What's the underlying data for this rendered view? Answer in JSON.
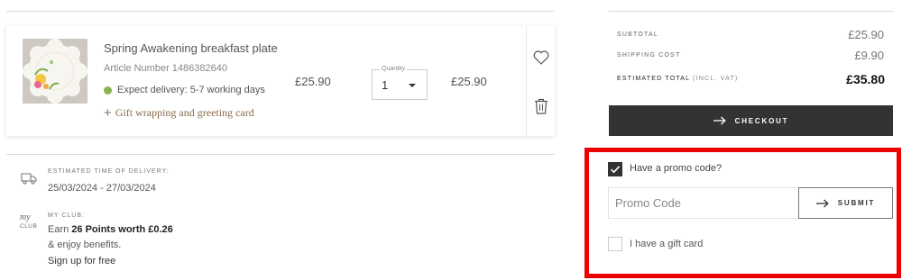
{
  "cart_item": {
    "title": "Spring Awakening breakfast plate",
    "article_number": "Article Number 1486382640",
    "delivery_estimate": "Expect delivery: 5-7 working days",
    "gift_wrapping_label": "Gift wrapping and greeting card",
    "unit_price": "£25.90",
    "quantity_label": "Quantity",
    "quantity_value": "1",
    "line_total": "£25.90",
    "status_color": "#8bb34f"
  },
  "delivery_info": {
    "label": "ESTIMATED TIME OF DELIVERY:",
    "dates": "25/03/2024 - 27/03/2024"
  },
  "club": {
    "logo_text": "MY CLUB",
    "label": "MY CLUB:",
    "earn_prefix": "Earn ",
    "points": "26 Points worth £0.26",
    "benefits": "& enjoy benefits.",
    "signup": "Sign up for free"
  },
  "summary": {
    "subtotal_label": "SUBTOTAL",
    "subtotal_value": "£25.90",
    "shipping_label": "SHIPPING COST",
    "shipping_value": "£9.90",
    "total_label": "ESTIMATED TOTAL",
    "total_label_note": "(INCL. VAT)",
    "total_value": "£35.80",
    "checkout_label": "CHECKOUT"
  },
  "promo": {
    "has_promo_label": "Have a promo code?",
    "has_promo_checked": true,
    "input_placeholder": "Promo Code",
    "input_value": "",
    "submit_label": "SUBMIT",
    "gift_card_label": "I have a gift card",
    "gift_card_checked": false,
    "highlight_color": "#ee0000"
  },
  "icons": [
    "product-thumbnail",
    "heart-icon",
    "trash-icon",
    "truck-icon",
    "my-club-logo",
    "arrow-right-icon",
    "checkmark-icon"
  ]
}
